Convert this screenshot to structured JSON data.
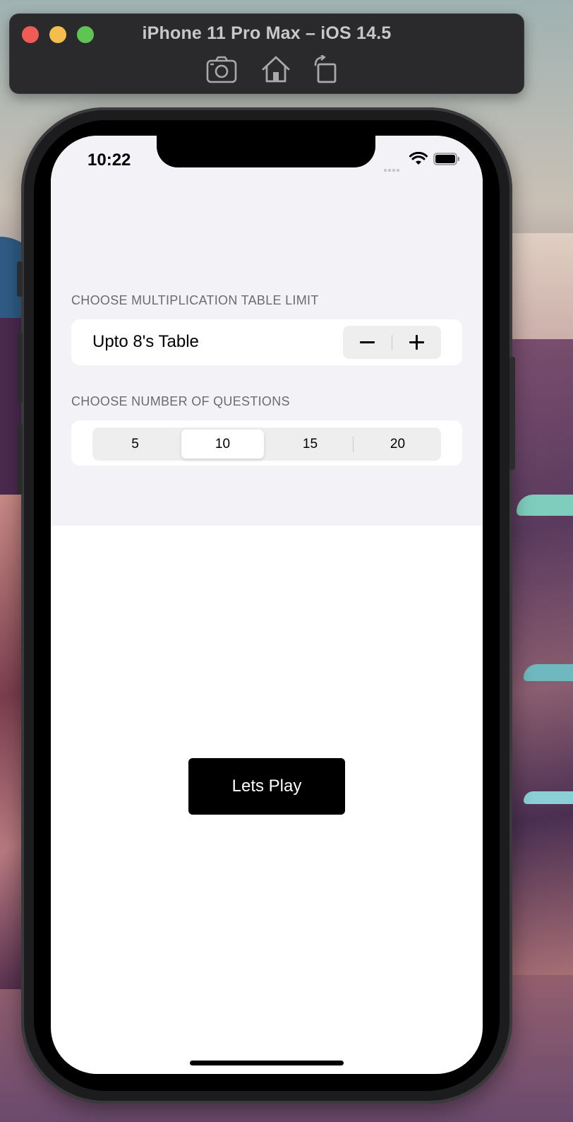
{
  "window": {
    "title": "iPhone 11 Pro Max – iOS 14.5",
    "toolbar_icons": [
      "camera-icon",
      "home-icon",
      "rotate-icon"
    ]
  },
  "status_bar": {
    "time": "10:22"
  },
  "sections": {
    "table_limit": {
      "header": "CHOOSE MULTIPLICATION TABLE LIMIT",
      "row_label": "Upto 8's Table"
    },
    "questions": {
      "header": "CHOOSE NUMBER OF QUESTIONS",
      "options": [
        "5",
        "10",
        "15",
        "20"
      ],
      "selected": "10"
    }
  },
  "play_button": {
    "label": "Lets Play"
  },
  "colors": {
    "form_background": "#f2f2f7",
    "header_text": "#6c6c70",
    "button_background": "#000000"
  }
}
